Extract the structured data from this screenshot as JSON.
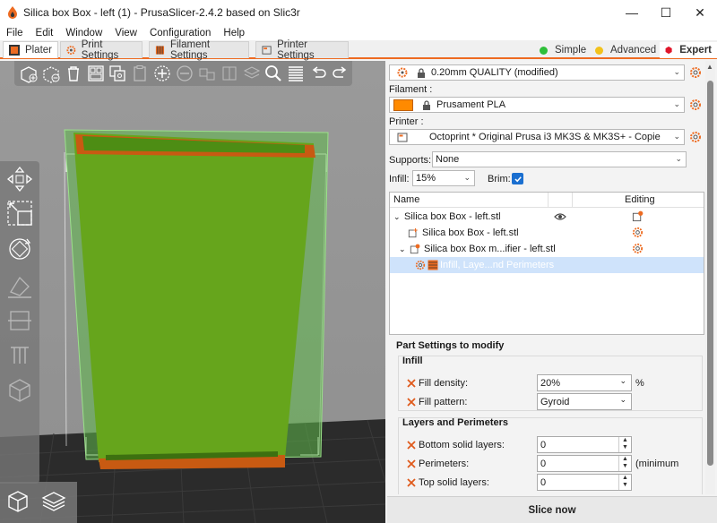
{
  "window": {
    "title": "Silica box Box - left (1) - PrusaSlicer-2.4.2 based on Slic3r",
    "minimize": "—",
    "maximize": "☐",
    "close": "✕"
  },
  "menu": [
    "File",
    "Edit",
    "Window",
    "View",
    "Configuration",
    "Help"
  ],
  "tabs": [
    {
      "label": "Plater",
      "active": true
    },
    {
      "label": "Print Settings",
      "active": false
    },
    {
      "label": "Filament Settings",
      "active": false
    },
    {
      "label": "Printer Settings",
      "active": false
    }
  ],
  "modes": [
    {
      "label": "Simple",
      "color": "#2fbf3a"
    },
    {
      "label": "Advanced",
      "color": "#f2c21c"
    },
    {
      "label": "Expert",
      "color": "#e0152a"
    }
  ],
  "settings": {
    "print_value": "0.20mm QUALITY (modified)",
    "filament_label": "Filament :",
    "filament_value": "Prusament PLA",
    "filament_color": "#ff8a00",
    "printer_label": "Printer :",
    "printer_value": "Octoprint * Original Prusa i3 MK3S & MK3S+ - Copie",
    "supports_label": "Supports:",
    "supports_value": "None",
    "infill_label": "Infill:",
    "infill_value": "15%",
    "brim_label": "Brim:",
    "brim_checked": true
  },
  "tree": {
    "col_name": "Name",
    "col_editing": "Editing",
    "rows": [
      {
        "label": "Silica box Box - left.stl"
      },
      {
        "label": "Silica box Box - left.stl"
      },
      {
        "label": "Silica box Box m...ifier - left.stl"
      },
      {
        "label": "Infill, Laye...nd Perimeters"
      }
    ]
  },
  "part_settings": {
    "title": "Part Settings to modify",
    "infill_group": "Infill",
    "fill_density_label": "Fill density:",
    "fill_density_value": "20%",
    "fill_density_unit": "%",
    "fill_pattern_label": "Fill pattern:",
    "fill_pattern_value": "Gyroid",
    "layers_group": "Layers and Perimeters",
    "bottom_label": "Bottom solid layers:",
    "bottom_value": "0",
    "perimeters_label": "Perimeters:",
    "perimeters_value": "0",
    "perimeters_unit": "(minimum",
    "top_label": "Top solid layers:",
    "top_value": "0"
  },
  "slice_button": "Slice now"
}
